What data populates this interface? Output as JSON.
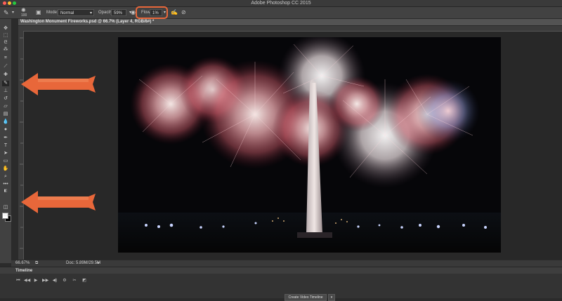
{
  "app": {
    "title": "Adobe Photoshop CC 2015"
  },
  "options_bar": {
    "brush_size": "100",
    "mode_label": "Mode:",
    "mode_value": "Normal",
    "opacity_label": "Opacity:",
    "opacity_value": "59%",
    "flow_label": "Flow:",
    "flow_value": "1%"
  },
  "document": {
    "tab_title": "Washington Monument Fireworks.psd @ 66.7% (Layer 4, RGB/8#) *"
  },
  "status": {
    "zoom": "66.67%",
    "doc_info": "Doc: 5.89M/29.5M"
  },
  "timeline": {
    "panel_title": "Timeline",
    "create_button": "Create Video Timeline"
  },
  "colors": {
    "highlight": "#e8673a",
    "arrow": "#e8673a",
    "foreground": "#ffffff",
    "background": "#000000"
  },
  "tools": [
    "move-icon",
    "marquee-icon",
    "lasso-icon",
    "quick-select-icon",
    "crop-icon",
    "eyedropper-icon",
    "healing-icon",
    "brush-icon",
    "clone-stamp-icon",
    "history-brush-icon",
    "eraser-icon",
    "gradient-icon",
    "blur-icon",
    "dodge-icon",
    "pen-icon",
    "type-icon",
    "path-select-icon",
    "rectangle-icon",
    "hand-icon",
    "zoom-icon",
    "more-icon"
  ]
}
